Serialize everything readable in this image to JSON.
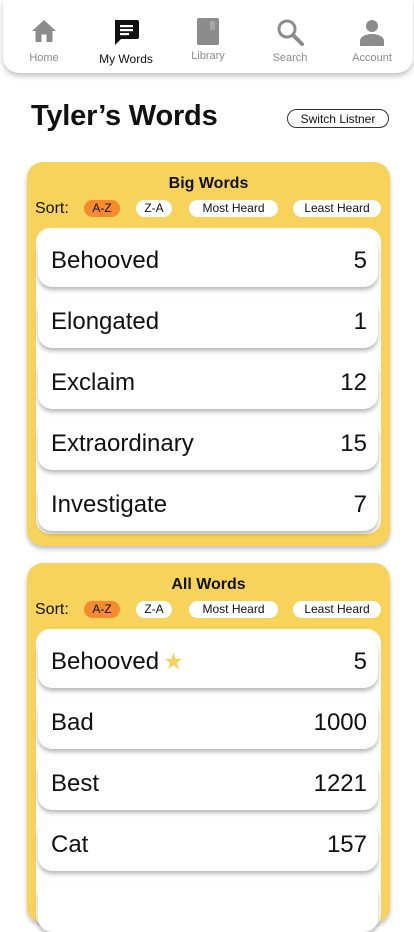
{
  "nav": {
    "items": [
      {
        "label": "Home",
        "icon": "home-icon"
      },
      {
        "label": "My Words",
        "icon": "notes-icon"
      },
      {
        "label": "Library",
        "icon": "book-icon"
      },
      {
        "label": "Search",
        "icon": "search-icon"
      },
      {
        "label": "Account",
        "icon": "person-icon"
      }
    ],
    "active": "My Words"
  },
  "header": {
    "title": "Tyler’s Words",
    "switch_label": "Switch Listner"
  },
  "big_words": {
    "title": "Big Words",
    "sort_label": "Sort:",
    "sort_options": [
      "A-Z",
      "Z-A",
      "Most Heard",
      "Least Heard"
    ],
    "selected_sort": "A-Z",
    "words": [
      {
        "word": "Behooved",
        "count": "5"
      },
      {
        "word": "Elongated",
        "count": "1"
      },
      {
        "word": "Exclaim",
        "count": "12"
      },
      {
        "word": "Extraordinary",
        "count": "15"
      },
      {
        "word": "Investigate",
        "count": "7"
      }
    ]
  },
  "all_words": {
    "title": "All Words",
    "sort_label": "Sort:",
    "sort_options": [
      "A-Z",
      "Z-A",
      "Most Heard",
      "Least Heard"
    ],
    "selected_sort": "A-Z",
    "words": [
      {
        "word": "Behooved",
        "count": "5",
        "starred": true
      },
      {
        "word": "Bad",
        "count": "1000"
      },
      {
        "word": "Best",
        "count": "1221"
      },
      {
        "word": "Cat",
        "count": "157"
      }
    ]
  },
  "colors": {
    "card": "#f7d35c",
    "selected_pill": "#f58b2e",
    "nav_inactive": "#8c8c8c",
    "star": "#f7d35c"
  }
}
